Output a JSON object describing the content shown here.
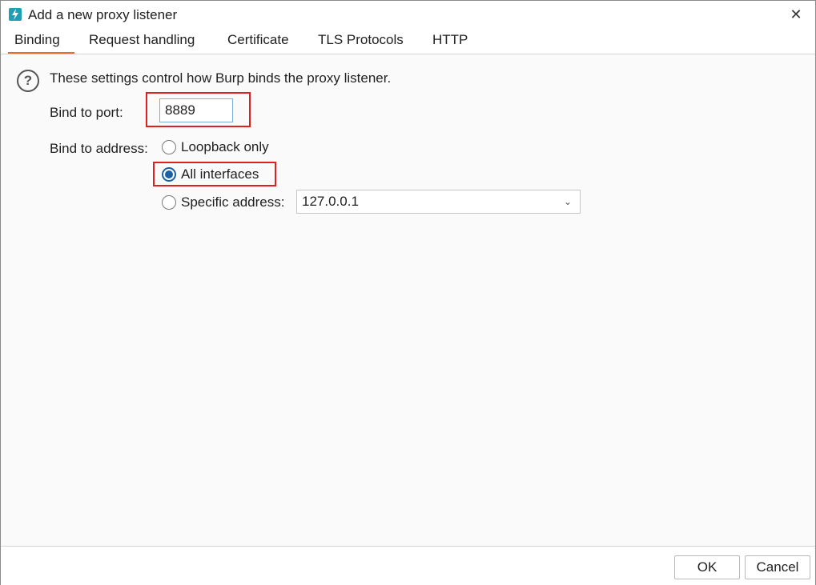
{
  "window": {
    "title": "Add a new proxy listener",
    "close_label": "✕",
    "app_icon": "burp-lightning-icon"
  },
  "tabs": [
    {
      "label": "Binding",
      "active": true
    },
    {
      "label": "Request handling",
      "active": false
    },
    {
      "label": "Certificate",
      "active": false
    },
    {
      "label": "TLS Protocols",
      "active": false
    },
    {
      "label": "HTTP",
      "active": false
    }
  ],
  "binding": {
    "help_icon": "question-icon",
    "help_text": "These settings control how Burp binds the proxy listener.",
    "port_label": "Bind to port:",
    "port_value": "8889",
    "address_label": "Bind to address:",
    "options": {
      "loopback": {
        "label": "Loopback only",
        "checked": false
      },
      "all": {
        "label": "All interfaces",
        "checked": true
      },
      "specific": {
        "label": "Specific address:",
        "checked": false
      }
    },
    "specific_address": "127.0.0.1"
  },
  "footer": {
    "ok_label": "OK",
    "cancel_label": "Cancel"
  },
  "colors": {
    "accent_tab": "#e4692b",
    "highlight": "#e02020",
    "radio_selected": "#1d5fa3",
    "app_icon": "#1e9fb3"
  }
}
